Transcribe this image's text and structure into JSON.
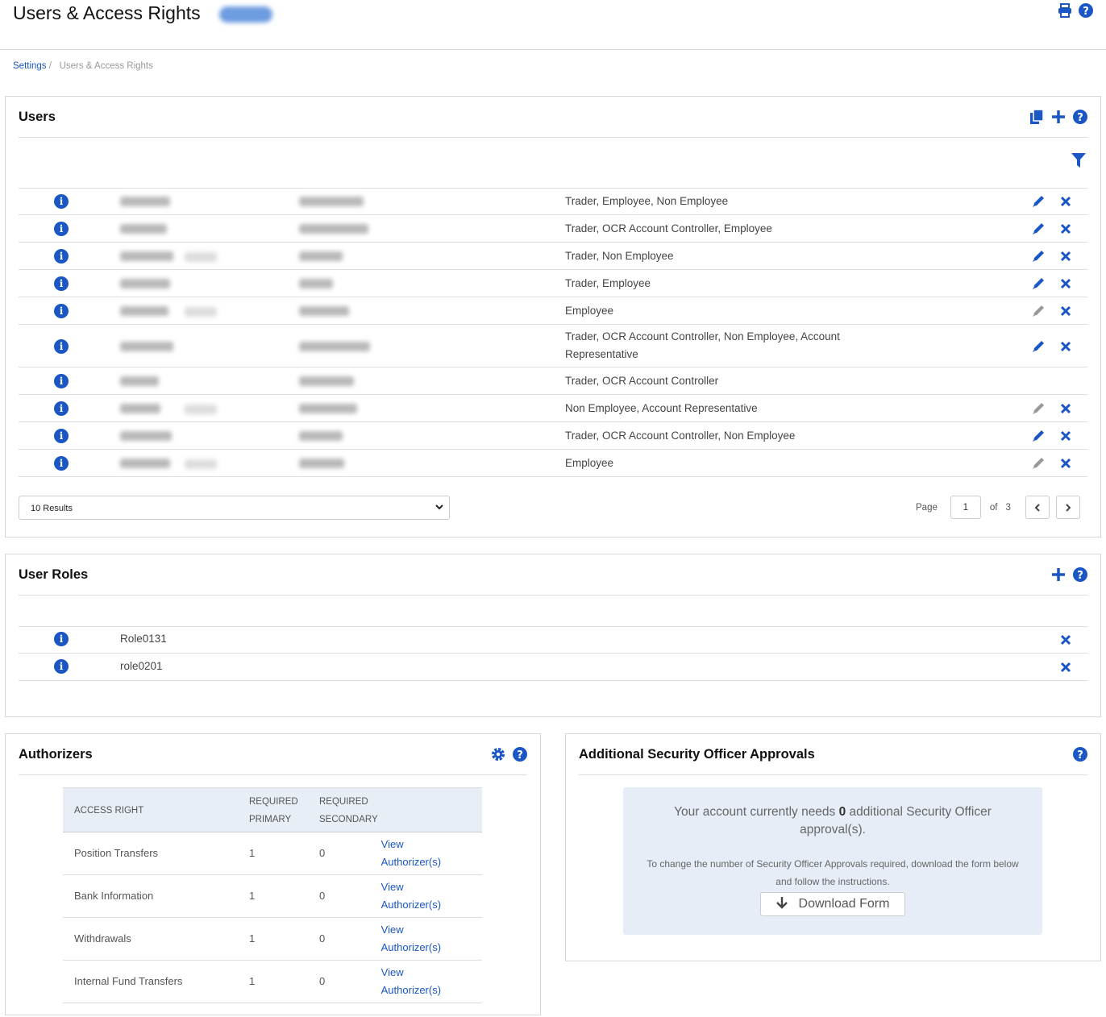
{
  "header": {
    "title": "Users & Access Rights",
    "icons": [
      "print-icon",
      "help-icon"
    ]
  },
  "breadcrumb": {
    "root": "Settings",
    "separator": "/",
    "current": "Users & Access Rights"
  },
  "accent": "#1a56c4",
  "users": {
    "title": "Users",
    "rows": [
      {
        "roles": "Trader, Employee, Non Employee",
        "edit": "enabled",
        "delete": true,
        "pending": false
      },
      {
        "roles": "Trader, OCR Account Controller, Employee",
        "edit": "enabled",
        "delete": true,
        "pending": false
      },
      {
        "roles": "Trader, Non Employee",
        "edit": "enabled",
        "delete": true,
        "pending": true
      },
      {
        "roles": "Trader, Employee",
        "edit": "enabled",
        "delete": true,
        "pending": false
      },
      {
        "roles": "Employee",
        "edit": "disabled",
        "delete": true,
        "pending": true
      },
      {
        "roles": "Trader, OCR Account Controller, Non Employee, Account Representative",
        "edit": "enabled",
        "delete": true,
        "pending": false
      },
      {
        "roles": "Trader, OCR Account Controller",
        "edit": "none",
        "delete": false,
        "pending": false
      },
      {
        "roles": "Non Employee, Account Representative",
        "edit": "disabled",
        "delete": true,
        "pending": true
      },
      {
        "roles": "Trader, OCR Account Controller, Non Employee",
        "edit": "enabled",
        "delete": true,
        "pending": false
      },
      {
        "roles": "Employee",
        "edit": "disabled",
        "delete": true,
        "pending": true
      }
    ],
    "results_select": "10 Results",
    "pagination": {
      "page_label": "Page",
      "page": "1",
      "of_label": "of",
      "total": "3"
    }
  },
  "roles": {
    "title": "User Roles",
    "rows": [
      {
        "name": "Role0131"
      },
      {
        "name": "role0201"
      }
    ]
  },
  "authorizers": {
    "title": "Authorizers",
    "headers": [
      "ACCESS RIGHT",
      "REQUIRED PRIMARY",
      "REQUIRED SECONDARY"
    ],
    "link_label": "View Authorizer(s)",
    "rows": [
      {
        "right": "Position Transfers",
        "primary": "1",
        "secondary": "0"
      },
      {
        "right": "Bank Information",
        "primary": "1",
        "secondary": "0"
      },
      {
        "right": "Withdrawals",
        "primary": "1",
        "secondary": "0"
      },
      {
        "right": "Internal Fund Transfers",
        "primary": "1",
        "secondary": "0"
      }
    ]
  },
  "security": {
    "title": "Additional Security Officer Approvals",
    "msg_pre": "Your account currently needs ",
    "count": "0",
    "msg_post": " additional Security Officer approval(s).",
    "instructions": "To change the number of Security Officer Approvals required, download the form below and follow the instructions.",
    "download_label": "Download Form"
  }
}
